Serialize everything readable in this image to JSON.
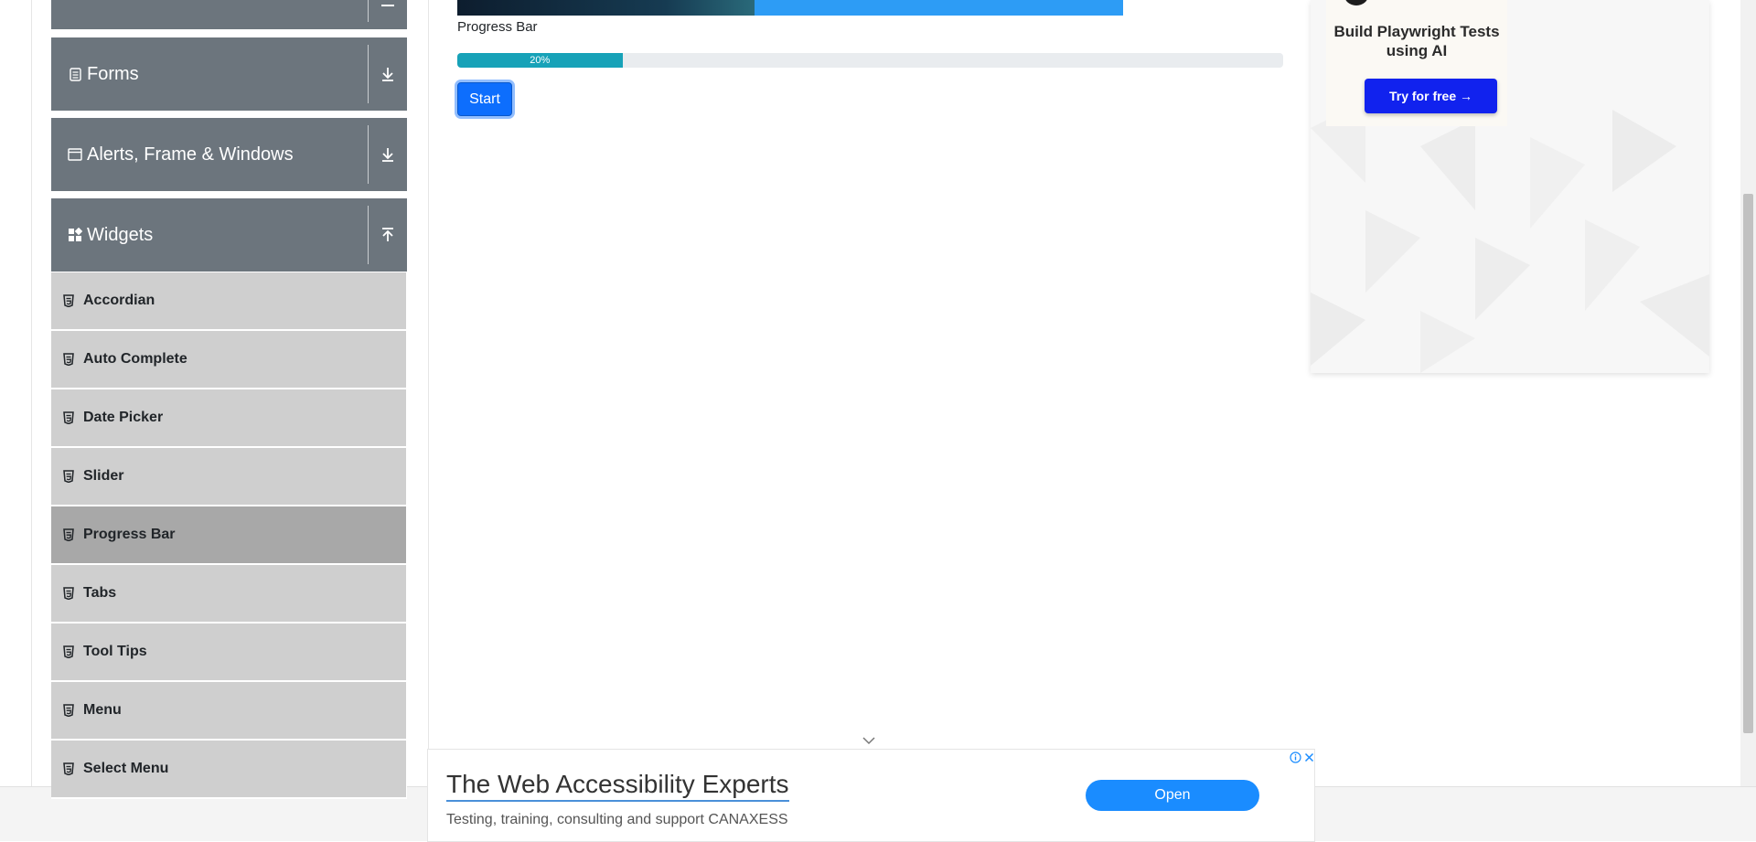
{
  "sidebar": {
    "groups": [
      {
        "label": "Forms",
        "icon": "form-icon",
        "arrow": "expand-arrow-icon"
      },
      {
        "label": "Alerts, Frame & Windows",
        "icon": "window-icon",
        "arrow": "expand-arrow-icon"
      },
      {
        "label": "Widgets",
        "icon": "widgets-icon",
        "arrow": "collapse-arrow-icon"
      }
    ],
    "widget_items": [
      {
        "label": "Accordian"
      },
      {
        "label": "Auto Complete"
      },
      {
        "label": "Date Picker"
      },
      {
        "label": "Slider"
      },
      {
        "label": "Progress Bar",
        "active": true
      },
      {
        "label": "Tabs"
      },
      {
        "label": "Tool Tips"
      },
      {
        "label": "Menu"
      },
      {
        "label": "Select Menu"
      }
    ]
  },
  "main": {
    "progress_label": "Progress Bar",
    "progress": {
      "value": 20,
      "text": "20%"
    },
    "start_button": "Start"
  },
  "right_ad": {
    "title": "Build Playwright Tests using AI",
    "cta": "Try for free →"
  },
  "bottom_ad": {
    "headline": "The Web Accessibility Experts",
    "description": "Testing, training, consulting and support CANAXESS",
    "button": "Open"
  },
  "colors": {
    "sidebar_header": "#6c757d",
    "menu_item": "#cfcfcf",
    "menu_item_active": "#a8a8a8",
    "progress_fill": "#17a2b8",
    "start_button": "#0d6efd",
    "ad_cta": "#1122ee",
    "open_button": "#1a8cff"
  }
}
